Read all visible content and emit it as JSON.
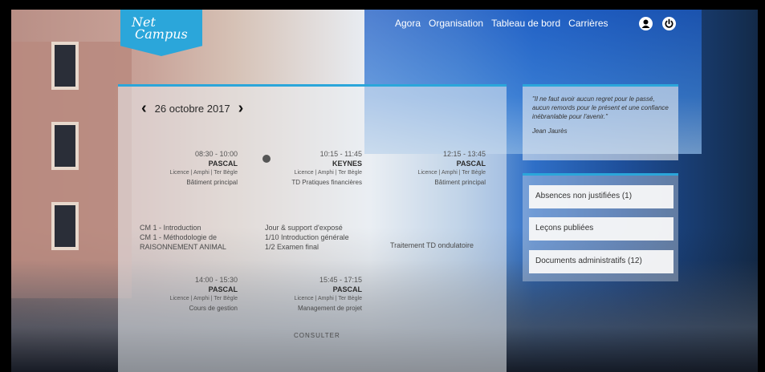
{
  "logo": {
    "line1": "Net",
    "line2": "Campus"
  },
  "nav": {
    "items": [
      {
        "label": "Agora"
      },
      {
        "label": "Organisation"
      },
      {
        "label": "Tableau de bord"
      },
      {
        "label": "Carrières"
      }
    ],
    "user_icon": "user-icon",
    "power_icon": "power-icon"
  },
  "schedule": {
    "date": "26 octobre 2017",
    "prev_icon": "chevron-left-icon",
    "next_icon": "chevron-right-icon",
    "lessons": [
      {
        "time": "08:30 - 10:00",
        "name": "PASCAL",
        "meta": "Licence | Amphi | Ter Bègle",
        "room": "Bâtiment principal"
      },
      {
        "time": "10:15 - 11:45",
        "name": "KEYNES",
        "meta": "Licence | Amphi | Ter Bègle",
        "room": "TD Pratiques financières"
      },
      {
        "time": "12:15 - 13:45",
        "name": "PASCAL",
        "meta": "Licence | Amphi | Ter Bègle",
        "room": "Bâtiment principal"
      },
      {
        "time": "14:00 - 15:30",
        "name": "PASCAL",
        "meta": "Licence | Amphi | Ter Bègle",
        "room": "Cours de gestion"
      },
      {
        "time": "15:45 - 17:15",
        "name": "PASCAL",
        "meta": "Licence | Amphi | Ter Bègle",
        "room": "Management de projet"
      }
    ],
    "notes": [
      {
        "lines": [
          "CM 1 - Introduction",
          "CM 1 - Méthodologie de",
          "RAISONNEMENT ANIMAL"
        ]
      },
      {
        "lines": [
          "Jour & support d'exposé",
          "1/10 Introduction générale",
          "1/2 Examen final"
        ]
      },
      {
        "lines": [
          "Traitement TD ondulatoire"
        ]
      }
    ],
    "footer": "CONSULTER"
  },
  "quote": {
    "text": "\"Il ne faut avoir aucun regret pour le passé, aucun remords pour le présent et une confiance inébranlable pour l'avenir.\"",
    "author": "Jean Jaurès"
  },
  "side_cards": [
    {
      "label": "Absences non justifiées (1)"
    },
    {
      "label": "Leçons publiées"
    },
    {
      "label": "Documents administratifs (12)"
    }
  ],
  "colors": {
    "accent": "#2ba6da"
  }
}
